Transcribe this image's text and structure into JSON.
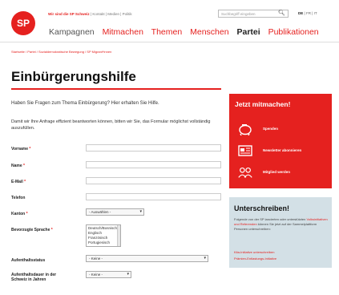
{
  "header": {
    "logo_text": "SP",
    "meta_strong": "Wir sind die SP Schweiz",
    "meta_links": "| Kontakt | Medien | Politik",
    "search_placeholder": "Suchbegriff eingeben",
    "lang_active": "DE",
    "lang_rest": "| FR | IT",
    "nav": [
      "Kampagnen",
      "Mitmachen",
      "Themen",
      "Menschen",
      "Partei",
      "Publikationen"
    ],
    "nav_active": "Partei"
  },
  "breadcrumb": "Startseite / Partei / Sozialdemokratische Bewegung / SP Migrant*innen",
  "page_title": "Einbürgerungshilfe",
  "intro": "Haben Sie Fragen zum Thema Einbürgerung? Hier erhalten Sie Hilfe.",
  "intro2": "Damit wir Ihre Anfrage effizient beantworten können, bitten wir Sie, das Formular möglichst vollständig auszufüllen.",
  "form": {
    "vorname": "Vorname",
    "name": "Name",
    "email": "E-Mail",
    "telefon": "Telefon",
    "kanton": "Kanton",
    "kanton_value": "- Auswählen -",
    "sprache": "Bevorzugte Sprache",
    "sprache_options": [
      "Deutsch/Bosnisch",
      "Englisch",
      "Französisch",
      "Portugiesisch"
    ],
    "aufenthaltsstatus": "Aufenthaltsstatus",
    "status_value": "- Keine -",
    "aufenthaltsdauer_1": "Aufenthaltsdauer in der",
    "aufenthaltsdauer_2": "Schweiz in Jahren",
    "dauer_value": "- Keine -",
    "required_mark": "*"
  },
  "cta": {
    "title": "Jetzt mitmachen!",
    "items": [
      {
        "label": "Spenden",
        "icon": "piggy-bank-icon"
      },
      {
        "label": "Newsletter abonnieren",
        "icon": "newsletter-icon"
      },
      {
        "label": "Mitglied werden",
        "icon": "people-icon"
      }
    ]
  },
  "sign": {
    "title": "Unterschreiben!",
    "text_1": "Folgende von der SP lancierten oder unterstützten",
    "text_hl": "Volksinitiativen und Referenden",
    "text_2": "können Sie jetzt auf der Sammelplattform",
    "text_3": "Personen unterschreiben:",
    "link_1": "Kita-Initiative unterschreiben",
    "link_2": "Prämien-Entlastungs-Initiative"
  },
  "colors": {
    "brand_red": "#e5211f",
    "sign_bg": "#d3e0e6"
  }
}
